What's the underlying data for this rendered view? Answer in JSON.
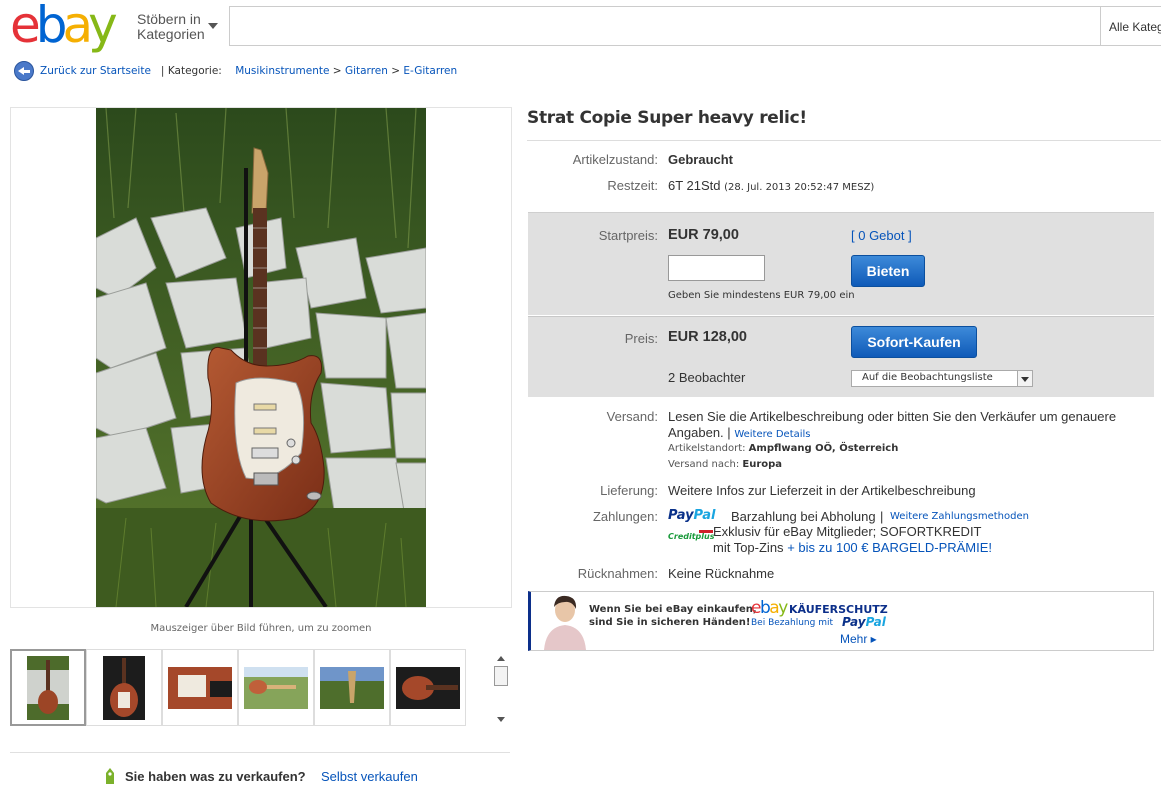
{
  "header": {
    "logo_letters": [
      "e",
      "b",
      "a",
      "y"
    ],
    "logo_colors": [
      "#e53238",
      "#0064d2",
      "#f5af02",
      "#86b817"
    ],
    "browse_line1": "Stöbern in",
    "browse_line2": "Kategorien",
    "search_value": "",
    "category_select": "Alle Kategorien"
  },
  "breadcrumb": {
    "back_label": "Zurück zur Startseite",
    "category_label": "Kategorie:",
    "path": [
      "Musikinstrumente",
      "Gitarren",
      "E-Gitarren"
    ],
    "separator": ">",
    "divider": "|"
  },
  "gallery": {
    "zoom_hint": "Mauszeiger über Bild führen, um zu zoomen",
    "thumbnails": 6,
    "selected_index": 0
  },
  "sell": {
    "question": "Sie haben was zu verkaufen?",
    "link": "Selbst verkaufen"
  },
  "item": {
    "title": "Strat Copie Super heavy relic!",
    "condition_label": "Artikelzustand:",
    "condition_value": "Gebraucht",
    "remaining_label": "Restzeit:",
    "remaining_value": "6T 21Std",
    "remaining_end": "(28. Jul. 2013  20:52:47 MESZ)",
    "start_price_label": "Startpreis:",
    "start_price": "EUR 79,00",
    "bids_link": "[ 0 Gebot ]",
    "bid_input_value": "",
    "bid_button": "Bieten",
    "bid_hint": "Geben Sie mindestens EUR 79,00 ein",
    "price_label": "Preis:",
    "price": "EUR 128,00",
    "buy_button": "Sofort-Kaufen",
    "watchers": "2 Beobachter",
    "watch_select": "Auf die Beobachtungsliste",
    "shipping_label": "Versand:",
    "shipping_text_1": "Lesen Sie die Artikelbeschreibung oder bitten Sie den Verkäufer um genauere",
    "shipping_text_2": "Angaben.",
    "shipping_divider": "|",
    "shipping_details_link": "Weitere Details",
    "location_label": "Artikelstandort:",
    "location_value": "Ampflwang OÖ, Österreich",
    "ships_to_label": "Versand nach:",
    "ships_to_value": "Europa",
    "delivery_label": "Lieferung:",
    "delivery_value": "Weitere Infos zur Lieferzeit in der Artikelbeschreibung",
    "payment_label": "Zahlungen:",
    "paypal_1": "Pay",
    "paypal_2": "Pal",
    "payment_cash": "Barzahlung bei Abholung",
    "payment_divider": "|",
    "payment_more_link": "Weitere Zahlungsmethoden",
    "creditplus_logo": "Creditplus",
    "credit_line1": "Exklusiv für eBay Mitglieder; SOFORTKREDIT",
    "credit_line2": "mit Top-Zins",
    "credit_bonus": "+ bis zu 100 € BARGELD-PRÄMIE!",
    "returns_label": "Rücknahmen:",
    "returns_value": "Keine Rücknahme"
  },
  "banner": {
    "line1": "Wenn Sie bei eBay einkaufen,",
    "line2": "sind Sie in sicheren Händen!",
    "protection": "KÄUFERSCHUTZ",
    "paypal_prefix": "Bei Bezahlung mit",
    "more": "Mehr ▸"
  }
}
